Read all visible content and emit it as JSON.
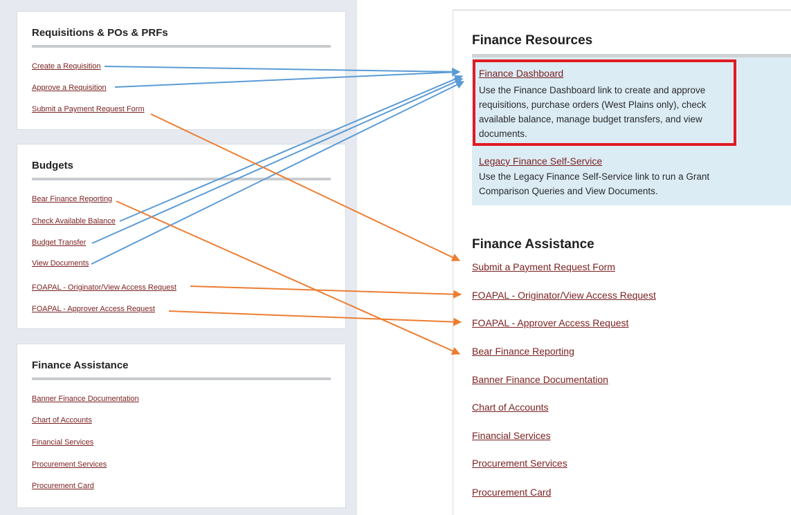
{
  "left": {
    "requisitions": {
      "title": "Requisitions & POs & PRFs",
      "links": [
        "Create a Requisition",
        "Approve a Requisition",
        "Submit a Payment Request Form"
      ]
    },
    "budgets": {
      "title": "Budgets",
      "links": [
        "Bear Finance Reporting",
        "Check Available Balance",
        "Budget Transfer",
        "View Documents",
        "FOAPAL - Originator/View Access Request",
        "FOAPAL - Approver Access Request"
      ]
    },
    "assistance": {
      "title": "Finance Assistance",
      "links": [
        "Banner Finance Documentation",
        "Chart of Accounts",
        "Financial Services",
        "Procurement Services",
        "Procurement Card"
      ]
    }
  },
  "right": {
    "resources": {
      "title": "Finance Resources",
      "items": [
        {
          "label": "Finance Dashboard",
          "desc": "Use the Finance Dashboard link to create and approve requisitions, purchase orders (West Plains only), check available balance, manage budget transfers, and view documents."
        },
        {
          "label": "Legacy Finance Self-Service",
          "desc": "Use the Legacy Finance Self-Service link to run a Grant Comparison Queries and View Documents."
        }
      ]
    },
    "assistance": {
      "title": "Finance Assistance",
      "links": [
        "Submit a Payment Request Form",
        "FOAPAL - Originator/View Access Request",
        "FOAPAL - Approver Access Request",
        "Bear Finance Reporting",
        "Banner Finance Documentation",
        "Chart of Accounts",
        "Financial Services",
        "Procurement Services",
        "Procurement Card"
      ]
    }
  },
  "colors": {
    "blue_arrow": "#5b9bd5",
    "orange_arrow": "#ed7d31",
    "highlight": "#e11b22",
    "link": "#7a1f1f",
    "panel_bg": "#dcecf5"
  }
}
